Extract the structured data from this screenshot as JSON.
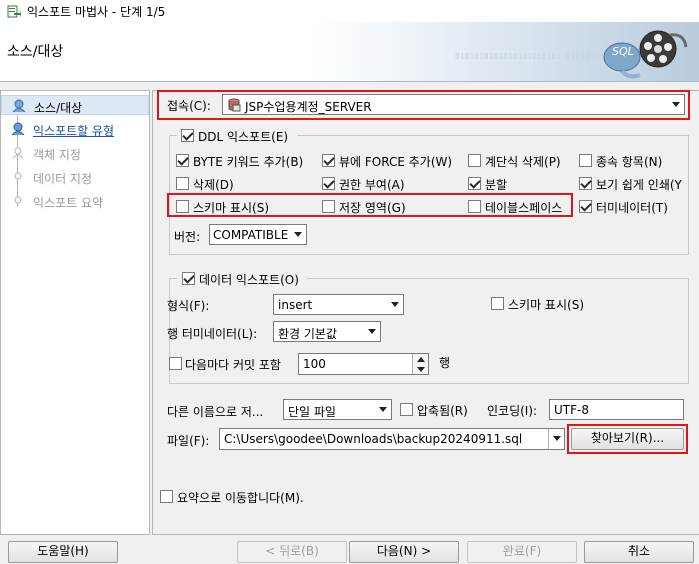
{
  "window": {
    "title": "익스포트 마법사 - 단계 1/5",
    "icon": "export-wizard-icon"
  },
  "header": {
    "title": "소스/대상",
    "bits": "0101010101010101010101 0101010110"
  },
  "nav": {
    "items": [
      {
        "label": "소스/대상",
        "state": "selected"
      },
      {
        "label": "익스포트할 유형",
        "state": "link"
      },
      {
        "label": "객체 지정",
        "state": "disabled"
      },
      {
        "label": "데이터 지정",
        "state": "disabled"
      },
      {
        "label": "익스포트 요약",
        "state": "disabled"
      }
    ]
  },
  "connection": {
    "label": "접속(C):",
    "value": "JSP수업용계정_SERVER"
  },
  "ddl": {
    "group_label": "DDL 익스포트(E)",
    "checked": true,
    "options": [
      {
        "label": "BYTE 키워드 추가(B)",
        "checked": true
      },
      {
        "label": "뷰에 FORCE 추가(W)",
        "checked": true
      },
      {
        "label": "계단식 삭제(P)",
        "checked": false
      },
      {
        "label": "종속 항목(N)",
        "checked": false
      },
      {
        "label": "삭제(D)",
        "checked": false
      },
      {
        "label": "권한 부여(A)",
        "checked": true
      },
      {
        "label": "분할",
        "checked": true
      },
      {
        "label": "보기 쉽게 인쇄(Y",
        "checked": true
      },
      {
        "label": "스키마 표시(S)",
        "checked": false
      },
      {
        "label": "저장 영역(G)",
        "checked": false
      },
      {
        "label": "테이블스페이스",
        "checked": false
      },
      {
        "label": "터미네이터(T)",
        "checked": true
      }
    ],
    "version_label": "버전:",
    "version_value": "COMPATIBLE"
  },
  "data_export": {
    "group_label": "데이터 익스포트(O)",
    "checked": true,
    "format_label": "형식(F):",
    "format_value": "insert",
    "show_schema_label": "스키마 표시(S)",
    "show_schema_checked": false,
    "row_terminator_label": "행 터미네이터(L):",
    "row_terminator_value": "환경 기본값",
    "commit_label": "다음마다 커밋 포함",
    "commit_checked": false,
    "commit_value": "100",
    "commit_unit": "행"
  },
  "output": {
    "save_as_label": "다른 이름으로 저...",
    "save_as_value": "단일 파일",
    "compressed_label": "압축됨(R)",
    "compressed_checked": false,
    "encoding_label": "인코딩(I):",
    "encoding_value": "UTF-8",
    "file_label": "파일(F):",
    "file_value": "C:\\Users\\goodee\\Downloads\\backup20240911.sql",
    "browse_label": "찾아보기(R)..."
  },
  "summary": {
    "label": "요약으로 이동합니다(M).",
    "checked": false
  },
  "buttons": {
    "help": "도움말(H)",
    "back": "< 뒤로(B)",
    "next": "다음(N) >",
    "finish": "완료(F)",
    "cancel": "취소"
  },
  "colors": {
    "highlight": "#e0151a",
    "link": "#1c52a8",
    "selection": "#dce8f6"
  }
}
